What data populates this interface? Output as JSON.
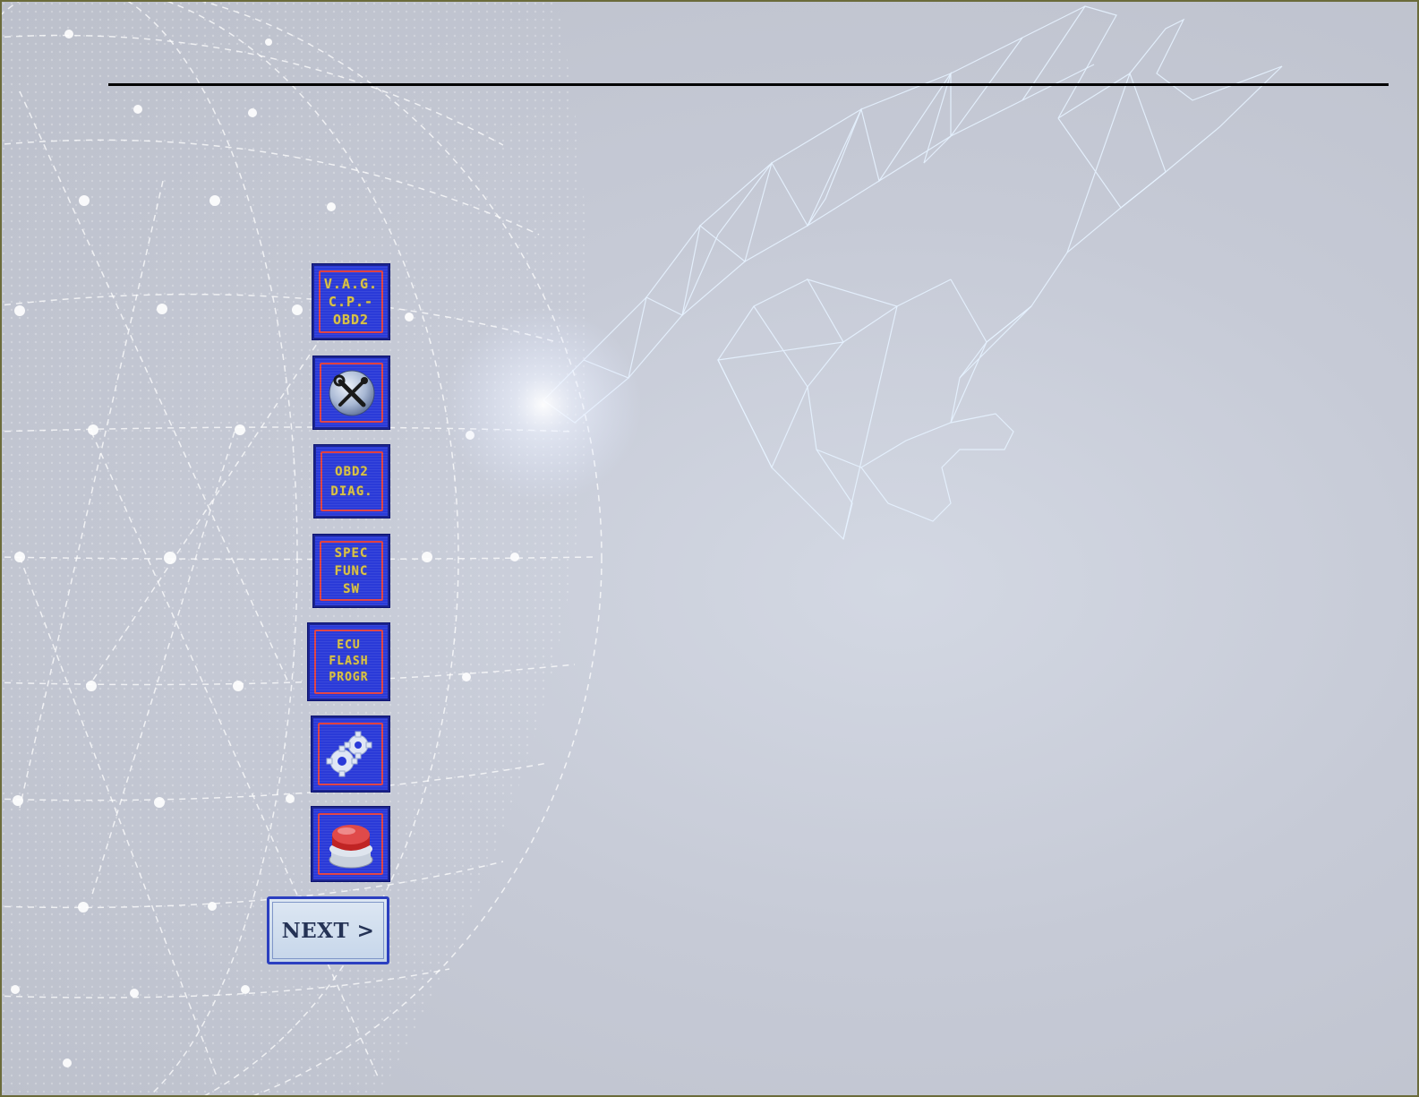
{
  "menu": {
    "items": [
      {
        "id": "vag-cp-obd2",
        "kind": "text",
        "label": "V.A.G.\nC.P.-\nOBD2"
      },
      {
        "id": "tools",
        "kind": "icon",
        "icon": "wrench-screwdriver-icon"
      },
      {
        "id": "obd2-diag",
        "kind": "text",
        "label": "OBD2\nDIAG."
      },
      {
        "id": "spec-func-sw",
        "kind": "text",
        "label": "SPEC\nFUNC\nSW"
      },
      {
        "id": "ecu-flash-progr",
        "kind": "text",
        "label": "ECU\nFLASH\nPROGR"
      },
      {
        "id": "settings",
        "kind": "icon",
        "icon": "gears-icon"
      },
      {
        "id": "exit",
        "kind": "icon",
        "icon": "red-push-button-icon"
      }
    ],
    "next_label": "NEXT >"
  },
  "colors": {
    "tile_bg": "#2a3ad8",
    "tile_frame": "#e04040",
    "tile_text": "#d8c24a",
    "header_rule": "#000000"
  }
}
